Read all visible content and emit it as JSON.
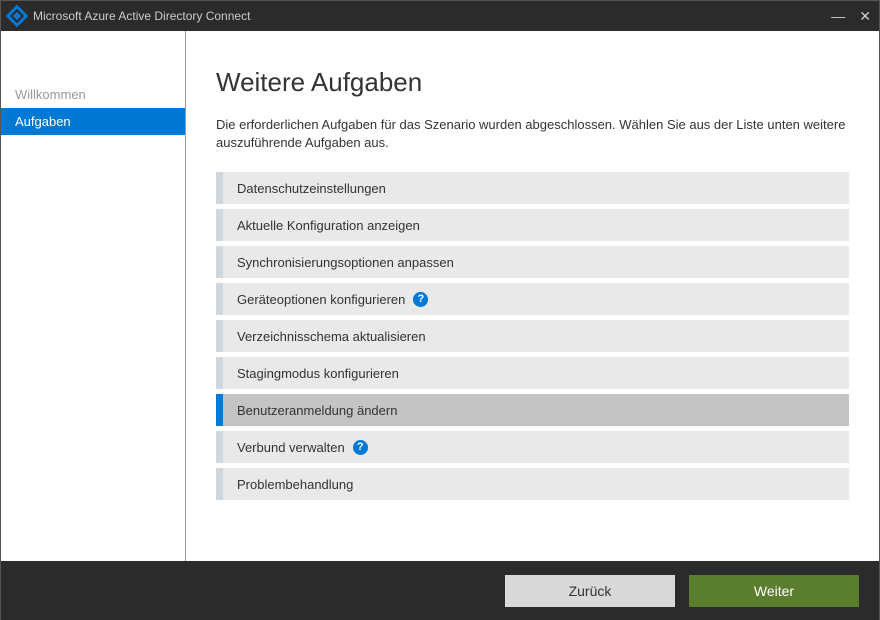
{
  "titlebar": {
    "title": "Microsoft Azure Active Directory Connect"
  },
  "sidebar": {
    "items": [
      {
        "label": "Willkommen",
        "active": false
      },
      {
        "label": "Aufgaben",
        "active": true
      }
    ]
  },
  "main": {
    "title": "Weitere Aufgaben",
    "description": "Die erforderlichen Aufgaben für das Szenario wurden abgeschlossen. Wählen Sie aus der Liste unten weitere auszuführende Aufgaben aus.",
    "tasks": [
      {
        "label": "Datenschutzeinstellungen",
        "help": false,
        "selected": false
      },
      {
        "label": "Aktuelle Konfiguration anzeigen",
        "help": false,
        "selected": false
      },
      {
        "label": "Synchronisierungsoptionen anpassen",
        "help": false,
        "selected": false
      },
      {
        "label": "Geräteoptionen konfigurieren",
        "help": true,
        "selected": false
      },
      {
        "label": "Verzeichnisschema aktualisieren",
        "help": false,
        "selected": false
      },
      {
        "label": "Stagingmodus konfigurieren",
        "help": false,
        "selected": false
      },
      {
        "label": "Benutzeranmeldung ändern",
        "help": false,
        "selected": true
      },
      {
        "label": "Verbund verwalten",
        "help": true,
        "selected": false
      },
      {
        "label": "Problembehandlung",
        "help": false,
        "selected": false
      }
    ]
  },
  "footer": {
    "back_label": "Zurück",
    "next_label": "Weiter"
  }
}
